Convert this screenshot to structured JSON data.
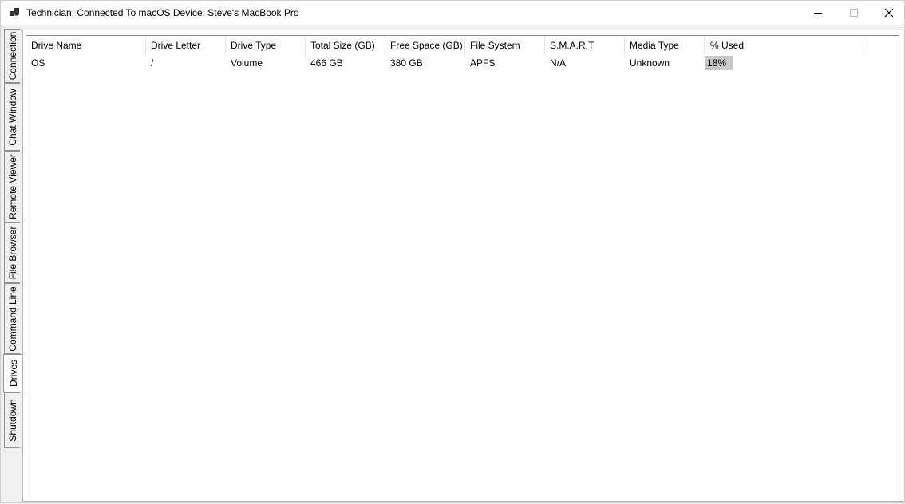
{
  "window": {
    "title": "Technician: Connected To macOS Device: Steve's MacBook Pro",
    "app_icon": "app-icon"
  },
  "tabs": [
    {
      "label": "Connection",
      "active": false
    },
    {
      "label": "Chat Window",
      "active": false
    },
    {
      "label": "Remote Viewer",
      "active": false
    },
    {
      "label": "File Browser",
      "active": false
    },
    {
      "label": "Command Line",
      "active": false
    },
    {
      "label": "Drives",
      "active": true
    },
    {
      "label": "Shutdown",
      "active": false
    }
  ],
  "drives_table": {
    "columns": [
      "Drive Name",
      "Drive Letter",
      "Drive Type",
      "Total Size (GB)",
      "Free Space (GB)",
      "File System",
      "S.M.A.R.T",
      "Media Type",
      "% Used"
    ],
    "rows": [
      {
        "drive_name": "OS",
        "drive_letter": "/",
        "drive_type": "Volume",
        "total_size": "466 GB",
        "free_space": "380 GB",
        "file_system": "APFS",
        "smart": "N/A",
        "media_type": "Unknown",
        "percent_used": "18%",
        "percent_used_value": 18
      }
    ]
  }
}
